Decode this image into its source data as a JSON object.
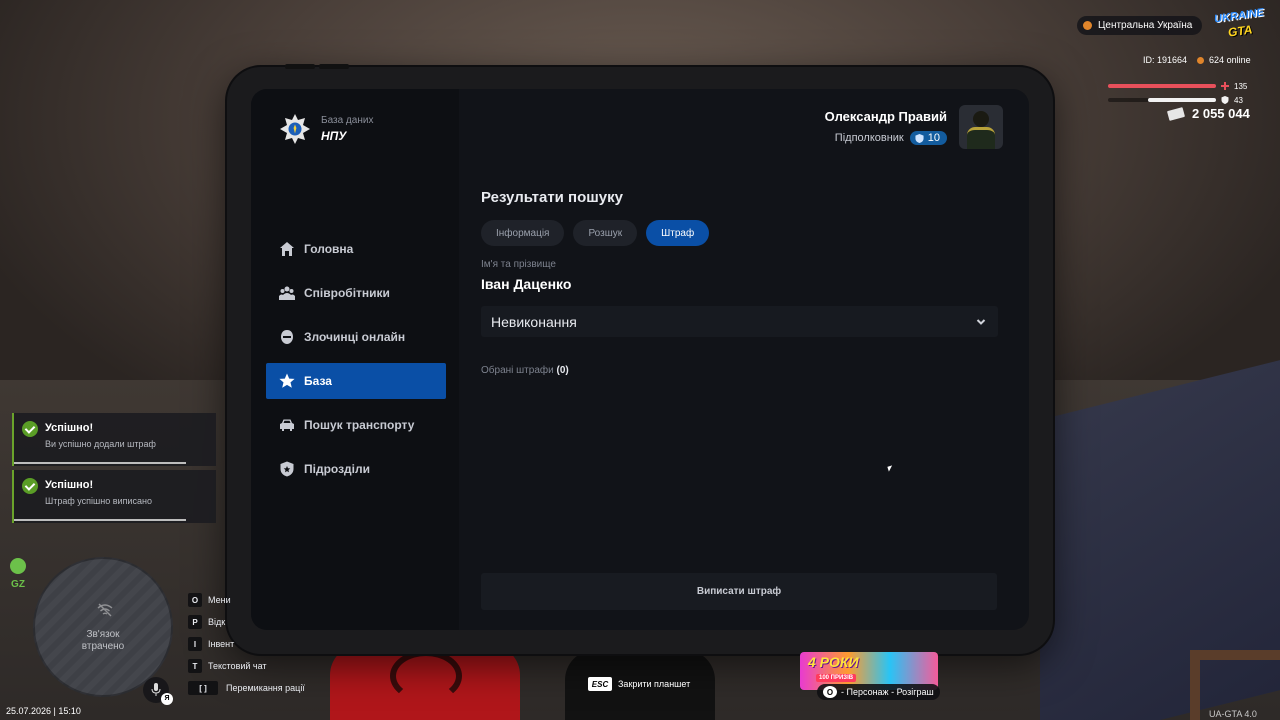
{
  "tablet": {
    "logo": {
      "subtitle": "База даних",
      "title": "НПУ"
    },
    "nav": [
      {
        "label": "Головна",
        "icon": "home-icon",
        "active": false
      },
      {
        "label": "Співробітники",
        "icon": "staff-icon",
        "active": false
      },
      {
        "label": "Злочинці онлайн",
        "icon": "criminal-mask-icon",
        "active": false
      },
      {
        "label": "База",
        "icon": "star-icon",
        "active": true
      },
      {
        "label": "Пошук транспорту",
        "icon": "car-icon",
        "active": false
      },
      {
        "label": "Підрозділи",
        "icon": "shield-icon",
        "active": false
      }
    ],
    "user": {
      "name": "Олександр Правий",
      "rank": "Підполковник",
      "level": "10"
    },
    "results_title": "Результати пошуку",
    "tabs": [
      {
        "label": "Інформація",
        "active": false
      },
      {
        "label": "Розшук",
        "active": false
      },
      {
        "label": "Штраф",
        "active": true
      }
    ],
    "field_label": "Ім'я та прізвище",
    "field_value": "Іван Даценко",
    "select_value": "Невиконання",
    "selected_label": "Обрані штрафи",
    "selected_count": "(0)",
    "issue_button": "Виписати штраф",
    "accent_color": "#0a4fa6"
  },
  "hud": {
    "region": "Центральна Україна",
    "logo_line1": "UKRAINE",
    "logo_line2": "GTA",
    "player_id": "ID: 191664",
    "online": "624 online",
    "health": "135",
    "armor": "43",
    "money": "2 055 044",
    "gz_label": "GZ",
    "minimap_status": "Зв'язок\nвтрачено",
    "datetime": "25.07.2026 | 15:10",
    "mic_lang": "Я",
    "version": "UA-GTA 4.0"
  },
  "notifications": [
    {
      "title": "Успішно!",
      "message": "Ви успішно додали штраф",
      "progress": 0.85
    },
    {
      "title": "Успішно!",
      "message": "Штраф успішно виписано",
      "progress": 0.85
    }
  ],
  "keybinds": [
    {
      "key": "O",
      "label": "Мени"
    },
    {
      "key": "P",
      "label": "Відк"
    },
    {
      "key": "I",
      "label": "Інвент"
    },
    {
      "key": "T",
      "label": "Текстовий чат"
    },
    {
      "key": "[ ]",
      "label": "Перемикання рації"
    }
  ],
  "esc_hint": {
    "key": "ESC",
    "label": "Закрити планшет"
  },
  "promo": {
    "title": "4 РОКИ",
    "badge": "100 ПРИЗІВ",
    "caption_key": "O",
    "caption": "- Персонаж - Розіграш"
  }
}
